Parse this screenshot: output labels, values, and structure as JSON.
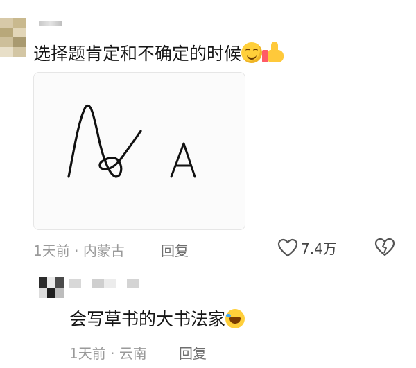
{
  "comment": {
    "text": "选择题肯定和不确定的时候",
    "emojis": [
      "smile-emoji",
      "thumbs-up-emoji"
    ],
    "image": {
      "handwritten_letters": [
        "A",
        "A"
      ]
    },
    "meta": {
      "time": "1天前",
      "separator": "·",
      "location": "内蒙古"
    },
    "reply_label": "回复",
    "like_count": "7.4万"
  },
  "reply": {
    "text": "会写草书的大书法家",
    "emoji": "laughing-emoji",
    "meta": {
      "time": "1天前",
      "separator": "·",
      "location": "云南"
    },
    "reply_label": "回复"
  },
  "icons": {
    "like": "heart-icon",
    "dislike": "broken-heart-icon"
  },
  "colors": {
    "meta_gray": "#9a9a9a",
    "text": "#161616",
    "icon": "#555555"
  }
}
